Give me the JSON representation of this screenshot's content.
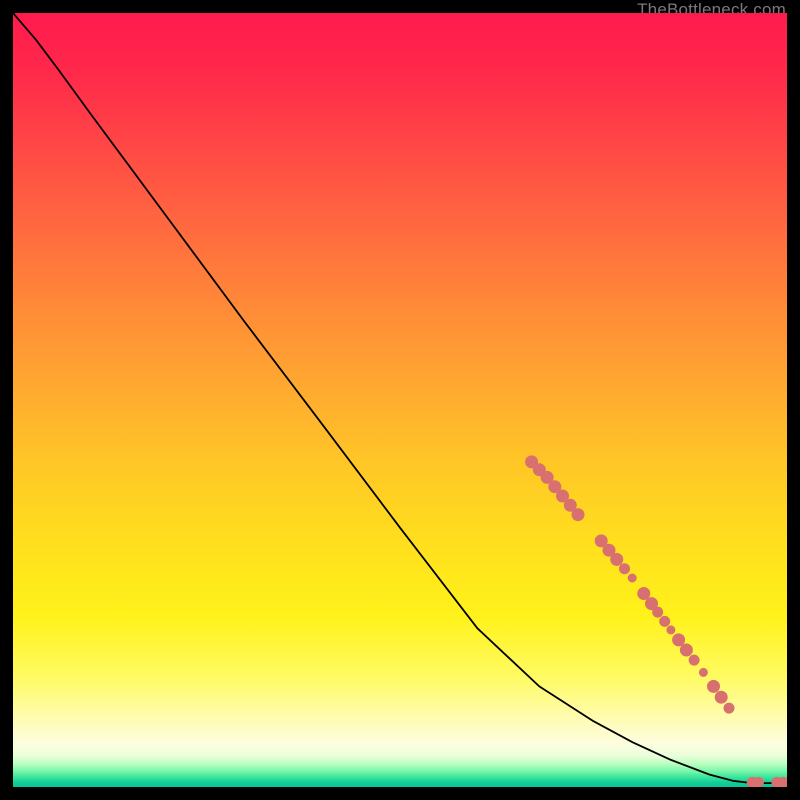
{
  "watermark": "TheBottleneck.com",
  "colors": {
    "dot": "#d97070",
    "line": "#000000"
  },
  "chart_data": {
    "type": "line",
    "x_range": [
      0,
      100
    ],
    "y_range": [
      0,
      100
    ],
    "title": "",
    "xlabel": "",
    "ylabel": "",
    "series": [
      {
        "name": "curve",
        "points": [
          {
            "x": 0.0,
            "y": 100.0
          },
          {
            "x": 3.0,
            "y": 96.5
          },
          {
            "x": 6.0,
            "y": 92.5
          },
          {
            "x": 10.0,
            "y": 87.0
          },
          {
            "x": 20.0,
            "y": 73.5
          },
          {
            "x": 30.0,
            "y": 60.0
          },
          {
            "x": 40.0,
            "y": 46.8
          },
          {
            "x": 50.0,
            "y": 33.5
          },
          {
            "x": 60.0,
            "y": 20.5
          },
          {
            "x": 68.0,
            "y": 13.0
          },
          {
            "x": 75.0,
            "y": 8.5
          },
          {
            "x": 80.0,
            "y": 5.8
          },
          {
            "x": 85.0,
            "y": 3.5
          },
          {
            "x": 90.0,
            "y": 1.6
          },
          {
            "x": 93.0,
            "y": 0.8
          },
          {
            "x": 95.5,
            "y": 0.5
          },
          {
            "x": 98.0,
            "y": 0.5
          },
          {
            "x": 100.0,
            "y": 0.5
          }
        ]
      }
    ],
    "markers": [
      {
        "x": 67.0,
        "y": 42.0,
        "r": 6
      },
      {
        "x": 68.0,
        "y": 41.0,
        "r": 6
      },
      {
        "x": 69.0,
        "y": 40.0,
        "r": 6
      },
      {
        "x": 70.0,
        "y": 38.8,
        "r": 6
      },
      {
        "x": 71.0,
        "y": 37.6,
        "r": 6
      },
      {
        "x": 72.0,
        "y": 36.4,
        "r": 6
      },
      {
        "x": 73.0,
        "y": 35.2,
        "r": 6
      },
      {
        "x": 76.0,
        "y": 31.8,
        "r": 6
      },
      {
        "x": 77.0,
        "y": 30.6,
        "r": 6
      },
      {
        "x": 78.0,
        "y": 29.4,
        "r": 6
      },
      {
        "x": 79.0,
        "y": 28.2,
        "r": 5
      },
      {
        "x": 80.0,
        "y": 27.0,
        "r": 4
      },
      {
        "x": 81.5,
        "y": 25.0,
        "r": 6
      },
      {
        "x": 82.5,
        "y": 23.7,
        "r": 6
      },
      {
        "x": 83.3,
        "y": 22.6,
        "r": 5
      },
      {
        "x": 84.2,
        "y": 21.4,
        "r": 5
      },
      {
        "x": 85.0,
        "y": 20.3,
        "r": 4
      },
      {
        "x": 86.0,
        "y": 19.0,
        "r": 6
      },
      {
        "x": 87.0,
        "y": 17.7,
        "r": 6
      },
      {
        "x": 88.0,
        "y": 16.4,
        "r": 5
      },
      {
        "x": 89.2,
        "y": 14.8,
        "r": 4
      },
      {
        "x": 90.5,
        "y": 13.0,
        "r": 6
      },
      {
        "x": 91.5,
        "y": 11.6,
        "r": 6
      },
      {
        "x": 92.5,
        "y": 10.2,
        "r": 5
      },
      {
        "x": 95.5,
        "y": 0.6,
        "r": 5
      },
      {
        "x": 96.3,
        "y": 0.6,
        "r": 5
      },
      {
        "x": 98.7,
        "y": 0.6,
        "r": 5
      },
      {
        "x": 99.5,
        "y": 0.6,
        "r": 5
      }
    ],
    "comment": "Values are estimated from pixel positions on a 0-100 × 0-100 normalized coordinate system. y=100 at top of gradient area, y=0 at bottom. marker r is approximate pixel radius."
  }
}
